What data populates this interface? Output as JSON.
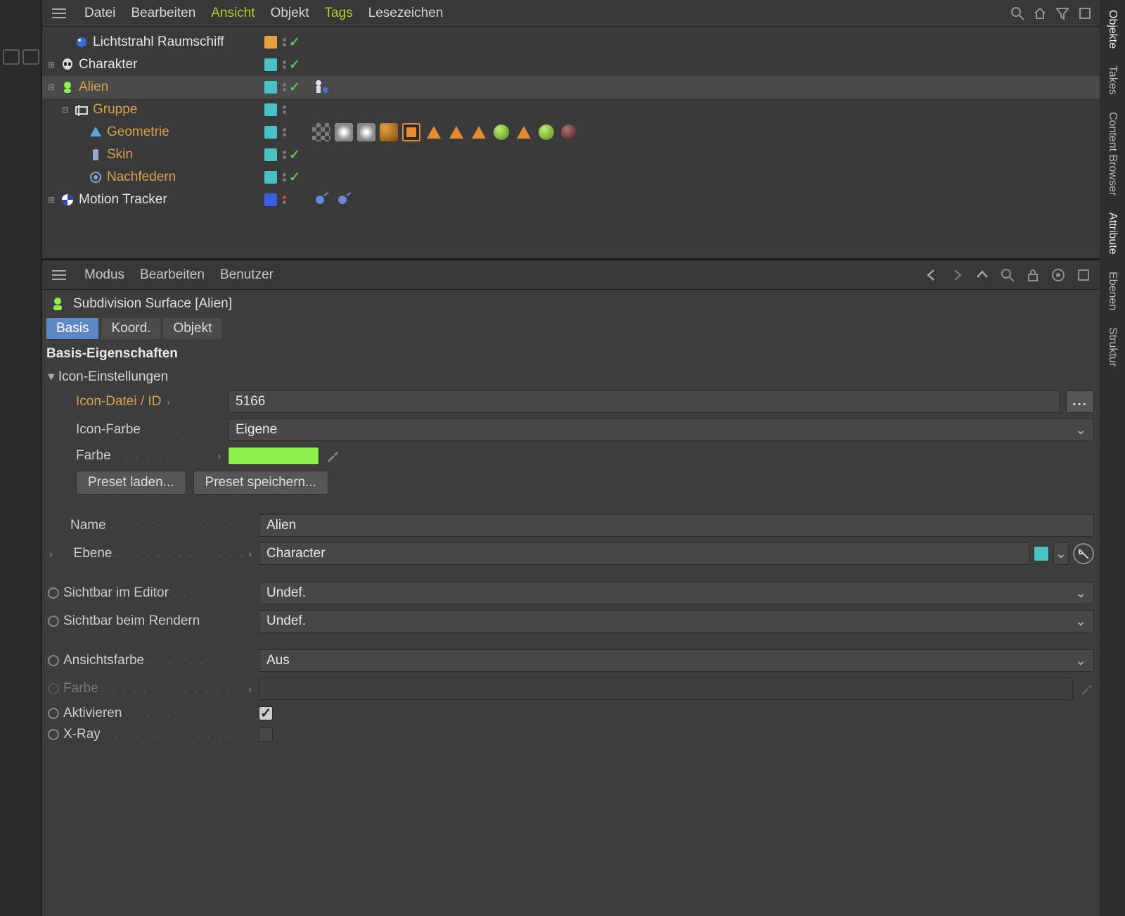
{
  "top_menu": {
    "items": [
      "Datei",
      "Bearbeiten",
      "Ansicht",
      "Objekt",
      "Tags",
      "Lesezeichen"
    ],
    "highlight_index": 2
  },
  "top_icons": [
    "search-icon",
    "home-icon",
    "filter-icon",
    "maximize-icon"
  ],
  "tree": [
    {
      "name": "Lichtstrahl Raumschiff",
      "indent": 1,
      "expander": "",
      "icon": "sphere-light",
      "label_color": "",
      "swatch": "sw-orange",
      "check": true,
      "selected": false,
      "tags": []
    },
    {
      "name": "Charakter",
      "indent": 0,
      "expander": "plus",
      "icon": "alien-head",
      "label_color": "",
      "swatch": "sw-teal",
      "check": true,
      "selected": false,
      "tags": []
    },
    {
      "name": "Alien",
      "indent": 0,
      "expander": "minus",
      "icon": "subdiv-green",
      "label_color": "orange",
      "swatch": "sw-teal",
      "check": true,
      "selected": true,
      "tags": [
        "pose"
      ]
    },
    {
      "name": "Gruppe",
      "indent": 1,
      "expander": "minus",
      "icon": "null-axis",
      "label_color": "orange",
      "swatch": "sw-teal",
      "check": false,
      "selected": false,
      "tags": []
    },
    {
      "name": "Geometrie",
      "indent": 2,
      "expander": "",
      "icon": "mesh-blue",
      "label_color": "orange",
      "swatch": "sw-teal",
      "check": false,
      "selected": false,
      "tags": [
        "checker",
        "weight",
        "weight2",
        "vertex",
        "sel-box",
        "tri",
        "tri",
        "tri",
        "ball-green",
        "tri",
        "ball-green",
        "ball-dark"
      ]
    },
    {
      "name": "Skin",
      "indent": 2,
      "expander": "",
      "icon": "skin",
      "label_color": "orange",
      "swatch": "sw-teal",
      "check": true,
      "selected": false,
      "tags": []
    },
    {
      "name": "Nachfedern",
      "indent": 2,
      "expander": "",
      "icon": "jiggle",
      "label_color": "orange",
      "swatch": "sw-teal",
      "check": true,
      "selected": false,
      "tags": []
    },
    {
      "name": "Motion Tracker",
      "indent": 0,
      "expander": "plus",
      "icon": "tracker",
      "label_color": "",
      "swatch": "sw-blue",
      "check": false,
      "red_dot": true,
      "selected": false,
      "tags": [
        "track1",
        "track2"
      ]
    }
  ],
  "attr_menu": {
    "items": [
      "Modus",
      "Bearbeiten",
      "Benutzer"
    ]
  },
  "attr_nav_icons": [
    "nav-back-icon",
    "nav-fwd-icon",
    "nav-up-icon",
    "search-icon",
    "lock-icon",
    "record-icon",
    "maximize-icon"
  ],
  "attr_title": "Subdivision Surface [Alien]",
  "tabs": [
    "Basis",
    "Koord.",
    "Objekt"
  ],
  "active_tab": 0,
  "section_heading": "Basis-Eigenschaften",
  "icon_section": {
    "title": "Icon-Einstellungen",
    "id_label": "Icon-Datei / ID",
    "id_value": "5166",
    "browse": "...",
    "color_mode_label": "Icon-Farbe",
    "color_mode_value": "Eigene",
    "color_label": "Farbe",
    "color_value": "#8df04a",
    "preset_load": "Preset laden...",
    "preset_save": "Preset speichern..."
  },
  "fields": {
    "name_label": "Name",
    "name_value": "Alien",
    "layer_label": "Ebene",
    "layer_value": "Character",
    "vis_editor_label": "Sichtbar im Editor",
    "vis_editor_value": "Undef.",
    "vis_render_label": "Sichtbar beim Rendern",
    "vis_render_value": "Undef.",
    "disp_color_label": "Ansichtsfarbe",
    "disp_color_value": "Aus",
    "color_label": "Farbe",
    "enable_label": "Aktivieren",
    "enable_value": true,
    "xray_label": "X-Ray",
    "xray_value": false
  },
  "right_tabs": [
    "Objekte",
    "Takes",
    "Content Browser",
    "Attribute",
    "Ebenen",
    "Struktur"
  ]
}
